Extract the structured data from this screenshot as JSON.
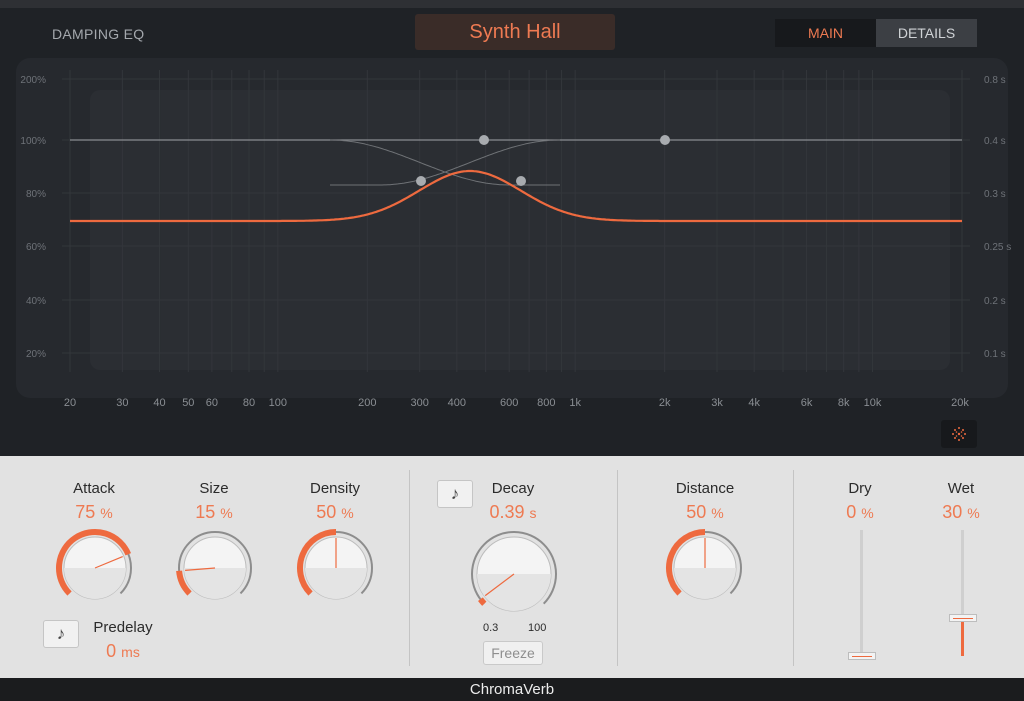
{
  "eq": {
    "title": "DAMPING EQ",
    "preset": "Synth Hall",
    "tabs": [
      "MAIN",
      "DETAILS"
    ],
    "y_left_ticks": [
      "200%",
      "100%",
      "80%",
      "60%",
      "40%",
      "20%"
    ],
    "y_right_ticks": [
      "0.8 s",
      "0.4 s",
      "0.3 s",
      "0.25 s",
      "0.2 s",
      "0.1 s"
    ],
    "x_ticks": [
      "20",
      "30",
      "40",
      "50",
      "60",
      "80",
      "100",
      "200",
      "300",
      "400",
      "600",
      "800",
      "1k",
      "2k",
      "3k",
      "4k",
      "6k",
      "8k",
      "10k",
      "20k"
    ],
    "colors": {
      "curve": "#ee6a3f",
      "flat_line": "#8a8d91",
      "handle": "#a8abaf"
    },
    "icon_sparkle": "sparkle-icon"
  },
  "controls": {
    "attack": {
      "label": "Attack",
      "value": "75",
      "unit": "%"
    },
    "size": {
      "label": "Size",
      "value": "15",
      "unit": "%"
    },
    "density": {
      "label": "Density",
      "value": "50",
      "unit": "%"
    },
    "predelay": {
      "label": "Predelay",
      "value": "0",
      "unit": "ms",
      "note_icon": "music-note-icon"
    },
    "decay": {
      "label": "Decay",
      "value": "0.39",
      "unit": "s",
      "range_min": "0.3",
      "range_max": "100",
      "freeze_label": "Freeze",
      "note_icon": "music-note-icon"
    },
    "distance": {
      "label": "Distance",
      "value": "50",
      "unit": "%"
    },
    "dry": {
      "label": "Dry",
      "value": "0",
      "unit": "%",
      "level": 0.0
    },
    "wet": {
      "label": "Wet",
      "value": "30",
      "unit": "%",
      "level": 0.3
    }
  },
  "footer": {
    "title": "ChromaVerb"
  }
}
